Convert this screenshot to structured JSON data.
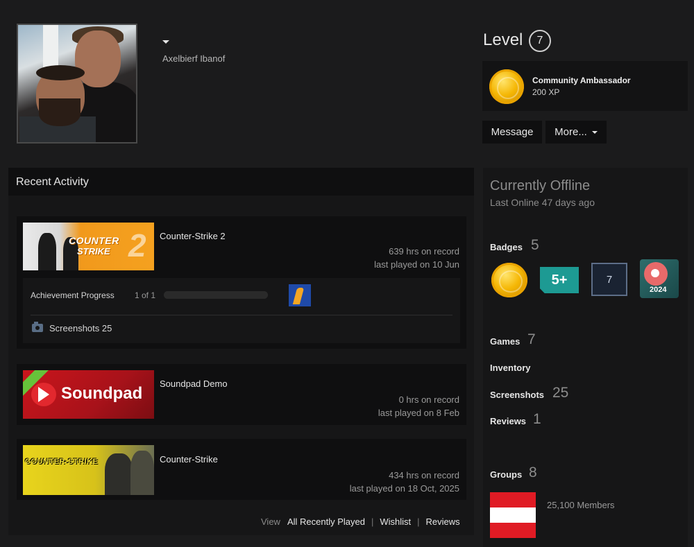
{
  "profile": {
    "username": "Axelbierf Ibanof",
    "level_label": "Level",
    "level": "7"
  },
  "featured_badge": {
    "icon": "gold-coin-badge",
    "title": "Community Ambassador",
    "xp": "200 XP"
  },
  "actions": {
    "message_label": "Message",
    "more_label": "More..."
  },
  "recent_activity": {
    "title": "Recent Activity",
    "games": [
      {
        "name": "Counter-Strike 2",
        "hours": "639 hrs on record",
        "last_played": "last played on 10 Jun",
        "capsule_text_1": "COUNTER",
        "capsule_text_2": "STRIKE",
        "capsule_text_3": "2"
      },
      {
        "name": "Soundpad Demo",
        "hours": "0 hrs on record",
        "last_played": "last played on 8 Feb",
        "capsule_text": "Soundpad"
      },
      {
        "name": "Counter-Strike",
        "hours": "434 hrs on record",
        "last_played": "last played on 18 Oct, 2025",
        "capsule_text": "COUNTER-STRIKE"
      }
    ],
    "achievement": {
      "label": "Achievement Progress",
      "count": "1 of 1",
      "progress": 1.0
    },
    "screenshots_label": "Screenshots 25",
    "footer": {
      "view": "View",
      "all_recently_played": "All Recently Played",
      "wishlist": "Wishlist",
      "reviews": "Reviews"
    }
  },
  "sidebar": {
    "status": "Currently Offline",
    "last_online": "Last Online 47 days ago",
    "badges": {
      "label": "Badges",
      "count": "5",
      "seven_label": "7",
      "five_label": "5+",
      "year_label": "2024"
    },
    "games": {
      "label": "Games",
      "count": "7"
    },
    "inventory": {
      "label": "Inventory"
    },
    "screenshots": {
      "label": "Screenshots",
      "count": "25"
    },
    "reviews": {
      "label": "Reviews",
      "count": "1"
    },
    "groups": {
      "label": "Groups",
      "count": "8",
      "members": "25,100 Members"
    }
  },
  "colors": {
    "background": "#1b1b1c",
    "panel": "#161617",
    "block": "#0f0f10",
    "coin": "#f5b705"
  }
}
